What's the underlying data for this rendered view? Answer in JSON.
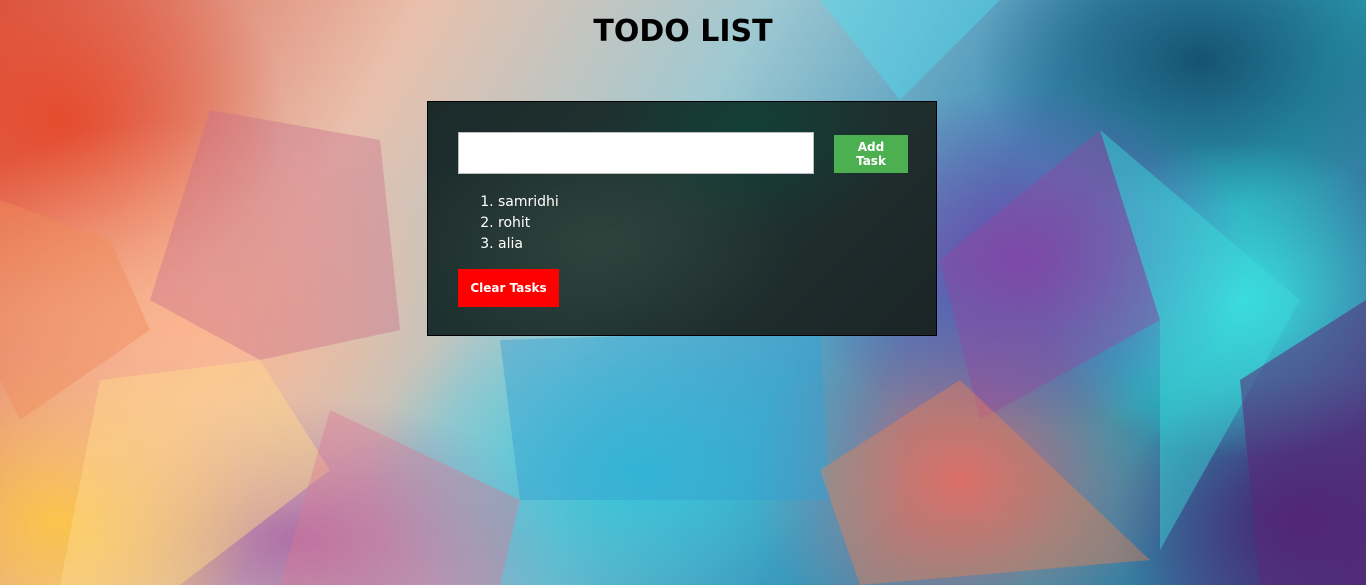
{
  "page": {
    "title": "TODO LIST"
  },
  "todo": {
    "input_value": "",
    "add_button_label": "Add Task",
    "clear_button_label": "Clear Tasks",
    "tasks": [
      "samridhi",
      "rohit",
      "alia"
    ]
  },
  "colors": {
    "add_button": "#4caf50",
    "clear_button": "#ff0000",
    "panel_background": "#1f3432",
    "title_text": "#000000",
    "task_text": "#ffffff"
  }
}
